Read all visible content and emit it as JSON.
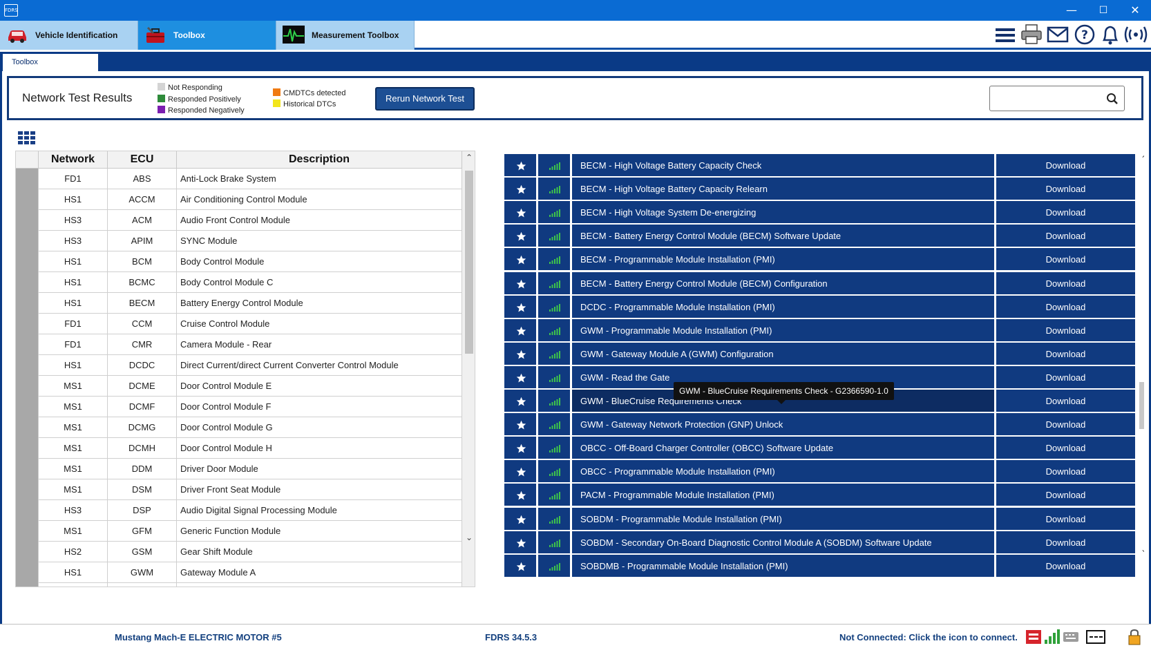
{
  "app": {
    "logo_text": "FDRS"
  },
  "window_controls": {
    "minimize": "—",
    "maximize": "☐",
    "close": "✕"
  },
  "main_tabs": [
    {
      "label": "Vehicle Identification",
      "icon": "car-icon"
    },
    {
      "label": "Toolbox",
      "icon": "toolbox-icon"
    },
    {
      "label": "Measurement Toolbox",
      "icon": "oscilloscope-icon"
    }
  ],
  "toolbar_icons": [
    "menu-icon",
    "printer-icon",
    "mail-icon",
    "help-icon",
    "bell-icon",
    "wireless-icon"
  ],
  "sub_tab": {
    "label": "Toolbox"
  },
  "network_test": {
    "title": "Network Test Results",
    "legend": [
      {
        "label": "Not Responding",
        "color": "#d4d4d4"
      },
      {
        "label": "Responded Positively",
        "color": "#2e8b3a"
      },
      {
        "label": "Responded Negatively",
        "color": "#7b1fb0"
      },
      {
        "label": "CMDTCs detected",
        "color": "#f07a12"
      },
      {
        "label": "Historical DTCs",
        "color": "#f2e51c"
      }
    ],
    "rerun_label": "Rerun Network Test",
    "search_value": ""
  },
  "ecu_table": {
    "headers": {
      "network": "Network",
      "ecu": "ECU",
      "description": "Description"
    },
    "rows": [
      {
        "network": "FD1",
        "ecu": "ABS",
        "description": "Anti-Lock Brake System"
      },
      {
        "network": "HS1",
        "ecu": "ACCM",
        "description": "Air Conditioning Control Module"
      },
      {
        "network": "HS3",
        "ecu": "ACM",
        "description": "Audio Front Control Module"
      },
      {
        "network": "HS3",
        "ecu": "APIM",
        "description": "SYNC Module"
      },
      {
        "network": "HS1",
        "ecu": "BCM",
        "description": "Body Control Module"
      },
      {
        "network": "HS1",
        "ecu": "BCMC",
        "description": "Body Control Module C"
      },
      {
        "network": "HS1",
        "ecu": "BECM",
        "description": "Battery Energy Control Module"
      },
      {
        "network": "FD1",
        "ecu": "CCM",
        "description": "Cruise Control Module"
      },
      {
        "network": "FD1",
        "ecu": "CMR",
        "description": "Camera Module - Rear"
      },
      {
        "network": "HS1",
        "ecu": "DCDC",
        "description": "Direct Current/direct Current Converter Control Module"
      },
      {
        "network": "MS1",
        "ecu": "DCME",
        "description": "Door Control Module E"
      },
      {
        "network": "MS1",
        "ecu": "DCMF",
        "description": "Door Control Module F"
      },
      {
        "network": "MS1",
        "ecu": "DCMG",
        "description": "Door Control Module G"
      },
      {
        "network": "MS1",
        "ecu": "DCMH",
        "description": "Door Control Module H"
      },
      {
        "network": "MS1",
        "ecu": "DDM",
        "description": "Driver Door Module"
      },
      {
        "network": "MS1",
        "ecu": "DSM",
        "description": "Driver Front Seat Module"
      },
      {
        "network": "HS3",
        "ecu": "DSP",
        "description": "Audio Digital Signal Processing Module"
      },
      {
        "network": "MS1",
        "ecu": "GFM",
        "description": "Generic Function Module"
      },
      {
        "network": "HS2",
        "ecu": "GSM",
        "description": "Gear Shift Module"
      },
      {
        "network": "HS1",
        "ecu": "GWM",
        "description": "Gateway Module A"
      },
      {
        "network": "",
        "ecu": "",
        "description": ""
      }
    ]
  },
  "tools": {
    "download_label": "Download",
    "items": [
      "BECM - High Voltage Battery Capacity Check",
      "BECM - High Voltage Battery Capacity Relearn",
      "BECM - High Voltage System De-energizing",
      "BECM - Battery Energy Control Module (BECM) Software Update",
      "BECM - Programmable Module Installation (PMI)",
      "BECM - Battery Energy Control Module (BECM) Configuration",
      "DCDC - Programmable Module Installation (PMI)",
      "GWM - Programmable Module Installation (PMI)",
      "GWM - Gateway Module A (GWM) Configuration",
      "GWM - Read the Gate",
      "GWM - BlueCruise Requirements Check",
      "GWM - Gateway Network Protection (GNP) Unlock",
      "OBCC - Off-Board Charger Controller (OBCC) Software Update",
      "OBCC - Programmable Module Installation (PMI)",
      "PACM - Programmable Module Installation (PMI)",
      "SOBDM - Programmable Module Installation (PMI)",
      "SOBDM - Secondary On-Board Diagnostic Control Module A (SOBDM) Software Update",
      "SOBDMB - Programmable Module Installation (PMI)"
    ],
    "tooltip": "GWM - BlueCruise Requirements Check - G2366590-1.0"
  },
  "status_bar": {
    "vehicle": "Mustang Mach-E ELECTRIC MOTOR #5",
    "version": "FDRS 34.5.3",
    "connection": "Not Connected: Click the icon to connect."
  },
  "colors": {
    "title_bar": "#0a6bd3",
    "navy": "#103a80",
    "status_text": "#123f7e"
  }
}
